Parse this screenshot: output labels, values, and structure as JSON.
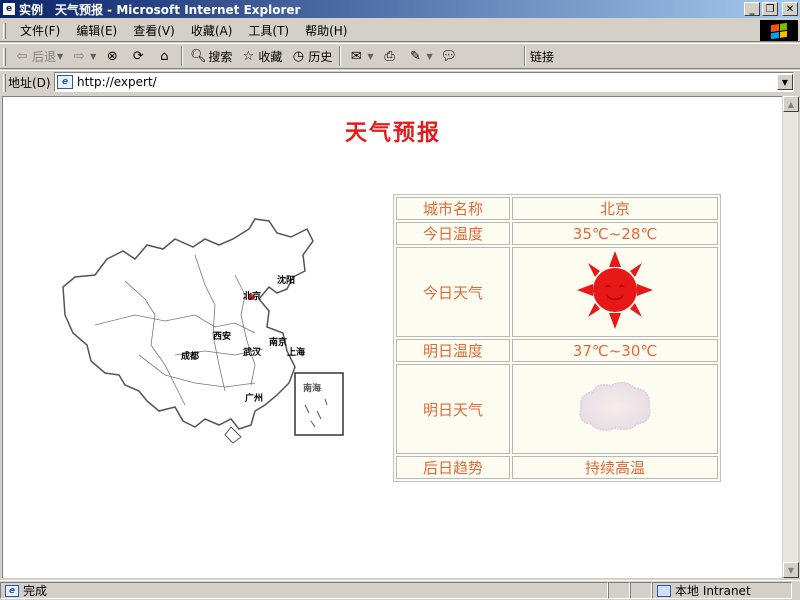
{
  "window": {
    "title": "实例　天气预报 - Microsoft Internet Explorer",
    "controls": [
      "_",
      "❐",
      "✕"
    ]
  },
  "menu": [
    "文件(F)",
    "编辑(E)",
    "查看(V)",
    "收藏(A)",
    "工具(T)",
    "帮助(H)"
  ],
  "toolbar": {
    "back": "后退",
    "search": "搜索",
    "favorites": "收藏",
    "history": "历史",
    "links": "链接"
  },
  "address": {
    "label": "地址(D)",
    "url": "http://expert/"
  },
  "page": {
    "heading": "天气预报",
    "map_labels": [
      "北京",
      "沈阳",
      "西安",
      "南京",
      "上海",
      "成都",
      "武汉",
      "广州",
      "南海"
    ],
    "weather_table": {
      "rows": [
        {
          "label": "城市名称",
          "value": "北京"
        },
        {
          "label": "今日温度",
          "value": "35℃~28℃"
        },
        {
          "label": "今日天气",
          "value_icon": "sun-icon"
        },
        {
          "label": "明日温度",
          "value": "37℃~30℃"
        },
        {
          "label": "明日天气",
          "value_icon": "cloud-icon"
        },
        {
          "label": "后日趋势",
          "value": "持续高温"
        }
      ]
    }
  },
  "status": {
    "text": "完成",
    "zone": "本地 Intranet"
  },
  "colors": {
    "heading": "#e31b1b",
    "table_text": "#e06a3a",
    "table_bg": "#fdfcf0",
    "sun": "#e81818"
  }
}
